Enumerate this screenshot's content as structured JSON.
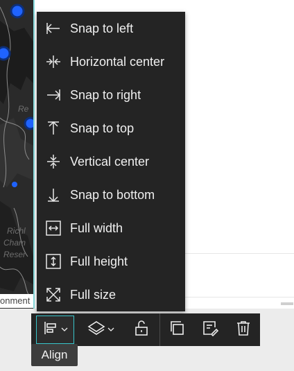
{
  "map": {
    "labels": [
      "Re",
      "Richl",
      "Cham",
      "Reser"
    ],
    "environment_label": "onment"
  },
  "align_menu": {
    "items": [
      {
        "label": "Snap to left",
        "icon": "snap-left-icon"
      },
      {
        "label": "Horizontal center",
        "icon": "horizontal-center-icon"
      },
      {
        "label": "Snap to right",
        "icon": "snap-right-icon"
      },
      {
        "label": "Snap to top",
        "icon": "snap-top-icon"
      },
      {
        "label": "Vertical center",
        "icon": "vertical-center-icon"
      },
      {
        "label": "Snap to bottom",
        "icon": "snap-bottom-icon"
      },
      {
        "label": "Full width",
        "icon": "full-width-icon"
      },
      {
        "label": "Full height",
        "icon": "full-height-icon"
      },
      {
        "label": "Full size",
        "icon": "full-size-icon"
      }
    ]
  },
  "toolbar": {
    "buttons": [
      {
        "name": "align",
        "icon": "align-left-icon",
        "has_dropdown": true,
        "active": true
      },
      {
        "name": "layers",
        "icon": "layers-icon",
        "has_dropdown": true,
        "active": false
      },
      {
        "name": "lock",
        "icon": "unlock-icon",
        "has_dropdown": false,
        "active": false
      },
      {
        "name": "duplicate",
        "icon": "copy-icon",
        "has_dropdown": false,
        "active": false
      },
      {
        "name": "edit",
        "icon": "edit-form-icon",
        "has_dropdown": false,
        "active": false
      },
      {
        "name": "delete",
        "icon": "trash-icon",
        "has_dropdown": false,
        "active": false
      }
    ],
    "tooltip": "Align"
  },
  "colors": {
    "menu_bg": "#242424",
    "text": "#f0f0f0",
    "accent": "#38c6cc",
    "map_dot": "#1f63ff"
  }
}
